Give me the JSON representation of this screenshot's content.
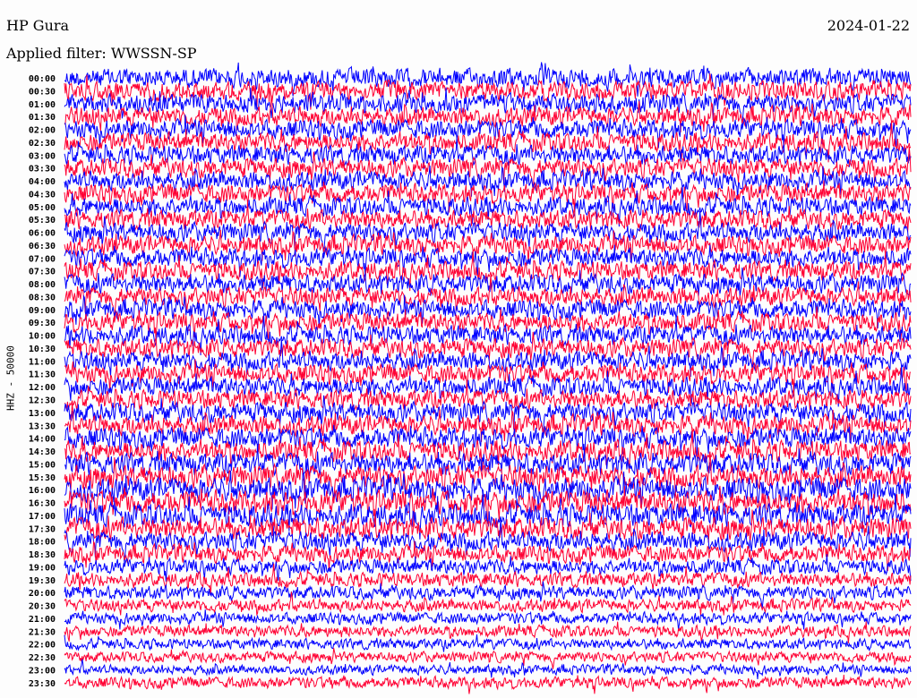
{
  "header": {
    "station": "HP Gura",
    "date": "2024-01-22",
    "filter": "Applied filter: WWSSN-SP"
  },
  "chart_data": {
    "type": "line",
    "title": "HP Gura",
    "date": "2024-01-22",
    "filter": "Applied filter: WWSSN-SP",
    "ylabel": "HHZ - 50000",
    "row_labels": [
      "00:00",
      "00:30",
      "01:00",
      "01:30",
      "02:00",
      "02:30",
      "03:00",
      "03:30",
      "04:00",
      "04:30",
      "05:00",
      "05:30",
      "06:00",
      "06:30",
      "07:00",
      "07:30",
      "08:00",
      "08:30",
      "09:00",
      "09:30",
      "10:00",
      "10:30",
      "11:00",
      "11:30",
      "12:00",
      "12:30",
      "13:00",
      "13:30",
      "14:00",
      "14:30",
      "15:00",
      "15:30",
      "16:00",
      "16:30",
      "17:00",
      "17:30",
      "18:00",
      "18:30",
      "19:00",
      "19:30",
      "20:00",
      "20:30",
      "21:00",
      "21:30",
      "22:00",
      "22:30",
      "23:00",
      "23:30"
    ],
    "trace_colors": [
      "#0000ff",
      "#ff0033"
    ],
    "relative_amplitude": [
      1.0,
      1.0,
      1.0,
      1.0,
      1.0,
      1.0,
      1.0,
      1.0,
      1.0,
      1.0,
      1.0,
      1.0,
      1.0,
      1.0,
      1.0,
      1.0,
      1.0,
      1.0,
      1.0,
      1.0,
      1.0,
      1.0,
      1.0,
      1.0,
      1.0,
      1.0,
      1.05,
      1.05,
      1.1,
      1.1,
      1.15,
      1.2,
      1.25,
      1.25,
      1.2,
      1.15,
      1.0,
      0.9,
      0.8,
      0.75,
      0.7,
      0.65,
      0.6,
      0.6,
      0.55,
      0.55,
      0.5,
      0.6
    ],
    "grid": false
  }
}
